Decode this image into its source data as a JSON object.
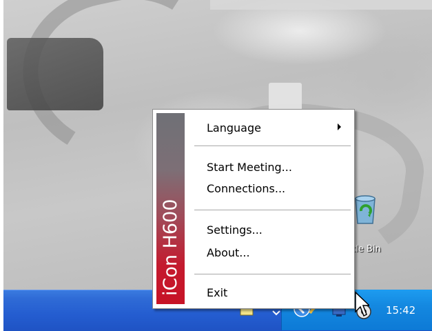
{
  "desktop": {
    "recycle_bin_label": "cle Bin"
  },
  "context_menu": {
    "brand_text": "iCon H600",
    "items": [
      {
        "label": "Language",
        "has_submenu": true
      },
      {
        "label": "Start Meeting..."
      },
      {
        "label": "Connections..."
      },
      {
        "label": "Settings..."
      },
      {
        "label": "About..."
      },
      {
        "label": "Exit"
      }
    ]
  },
  "taskbar": {
    "clock": "15:42"
  },
  "colors": {
    "taskbar_blue": "#245dd0",
    "tray_blue": "#1488e0",
    "brand_red": "#c71326",
    "brand_gray": "#6f7076"
  },
  "icons": [
    "recycle-bin-icon",
    "tray-notes-icon",
    "tray-expand-icon",
    "tray-back-icon",
    "tray-network-icon",
    "tray-icon-app",
    "mouse-cursor-icon",
    "submenu-arrow-icon"
  ]
}
